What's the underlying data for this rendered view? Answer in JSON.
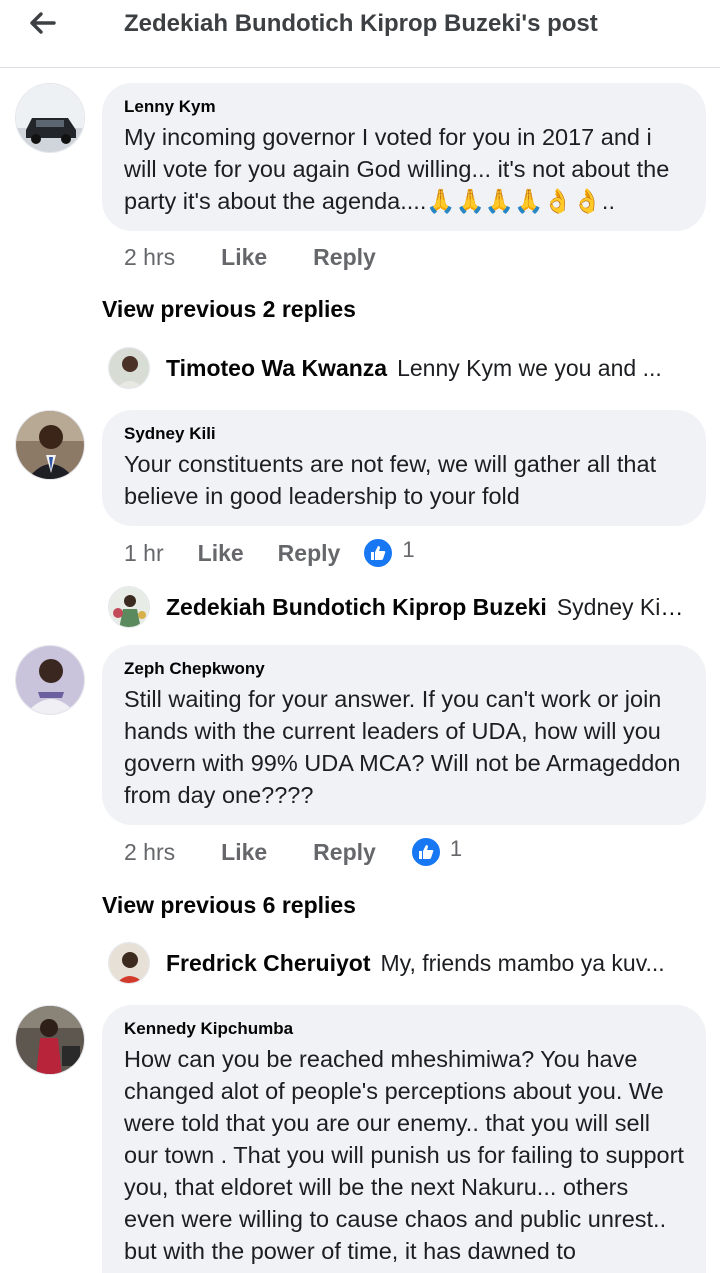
{
  "header": {
    "title": "Zedekiah Bundotich Kiprop Buzeki's post",
    "back_icon": "arrow-left-icon"
  },
  "comments": [
    {
      "author": "Lenny Kym",
      "text": "My incoming governor I voted for you in 2017 and i will vote for you again God willing... it's not about the party it's about the agenda....🙏🙏🙏🙏👌👌..",
      "time": "2 hrs",
      "like_label": "Like",
      "reply_label": "Reply"
    },
    {
      "author": "Sydney Kili",
      "text": "Your constituents are not few, we will gather all that believe in good leadership to your fold",
      "time": "1 hr",
      "like_label": "Like",
      "reply_label": "Reply",
      "reaction_count": "1"
    },
    {
      "author": "Zeph Chepkwony",
      "text": "Still waiting for your answer. If you can't work or join hands with the current leaders of UDA, how will you govern with 99% UDA MCA? Will not be Armageddon from day one????",
      "time": "2 hrs",
      "like_label": "Like",
      "reply_label": "Reply",
      "reaction_count": "1"
    },
    {
      "author": "Kennedy Kipchumba",
      "text": "How can you be reached mheshimiwa? You have changed alot of people's perceptions about you.  We were told that you are our enemy.. that you will sell our town . That you will punish us for failing to support you, that eldoret will be the next Nakuru... others even were willing to cause chaos and public unrest.. but with the power of time, it has dawned to"
    }
  ],
  "view_previous": [
    "View previous 2 replies",
    "View previous 6 replies"
  ],
  "replies": [
    {
      "author": "Timoteo Wa Kwanza",
      "snippet": "Lenny Kym we you and ..."
    },
    {
      "author": "Zedekiah Bundotich Kiprop Buzeki",
      "snippet": "Sydney Kili..."
    },
    {
      "author": "Fredrick Cheruiyot",
      "snippet": "My, friends mambo ya kuv..."
    }
  ],
  "colors": {
    "bubble": "#f0f2f5",
    "meta": "#65676b",
    "like_blue": "#1877f2"
  }
}
